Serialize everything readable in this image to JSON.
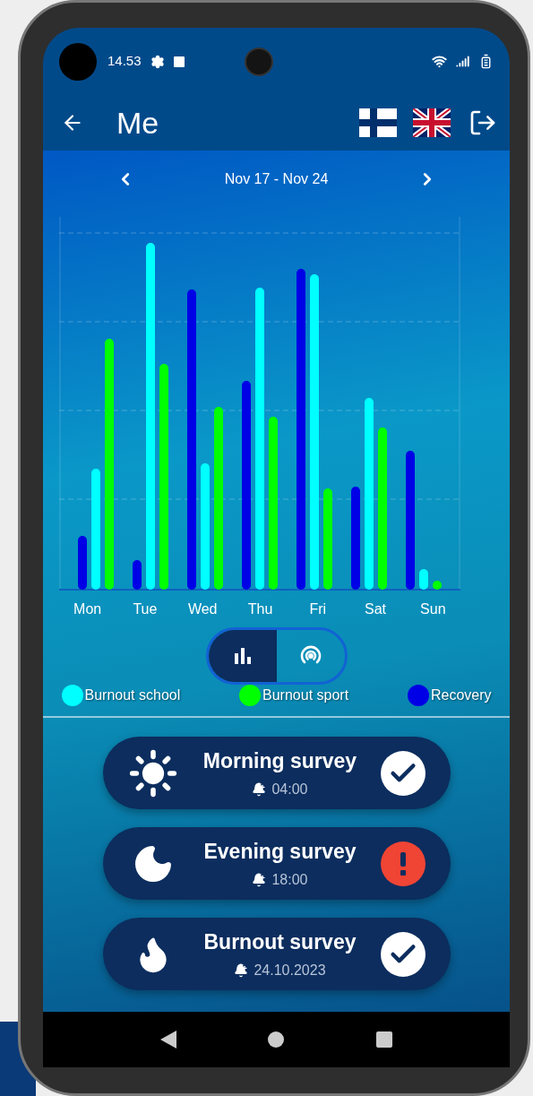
{
  "status_bar": {
    "time": "14.53"
  },
  "header": {
    "title": "Me"
  },
  "week": {
    "label": "Nov 17 - Nov 24"
  },
  "chart": {
    "days": [
      "Mon",
      "Tue",
      "Wed",
      "Thu",
      "Fri",
      "Sat",
      "Sun"
    ]
  },
  "view_toggle": [
    {
      "kind": "bars",
      "selected": true
    },
    {
      "kind": "radar",
      "selected": false
    }
  ],
  "legend": [
    {
      "label": "Burnout school",
      "color": "#00ffff"
    },
    {
      "label": "Burnout sport",
      "color": "#00ff00"
    },
    {
      "label": "Recovery",
      "color": "#0000e6"
    }
  ],
  "surveys": [
    {
      "kind": "sun",
      "title": "Morning survey",
      "time": "04:00",
      "completed": true
    },
    {
      "kind": "moon",
      "title": "Evening survey",
      "time": "18:00",
      "completed": false
    },
    {
      "kind": "flame",
      "title": "Burnout survey",
      "time": "24.10.2023",
      "completed": true
    }
  ]
}
